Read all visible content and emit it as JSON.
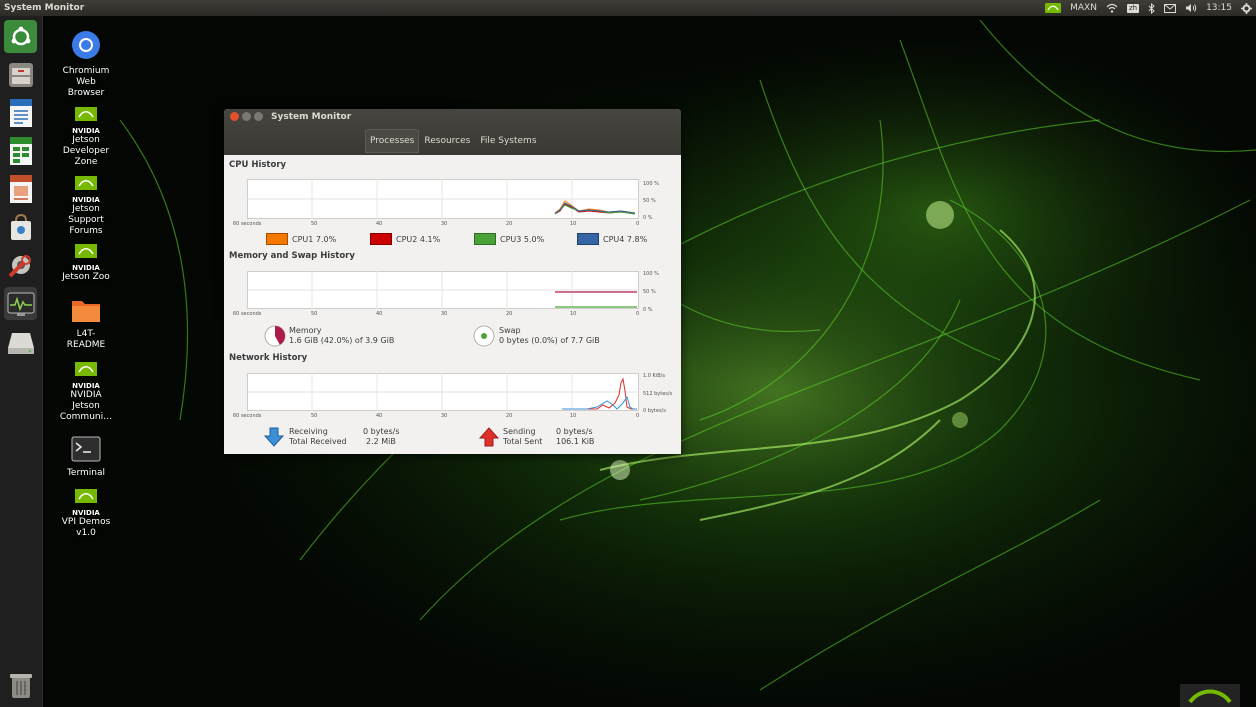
{
  "top_panel": {
    "app_title": "System Monitor",
    "tray": {
      "power_mode": "MAXN",
      "keyboard": "zh",
      "time": "13:15"
    },
    "icons": [
      "nvidia-icon",
      "wifi-icon",
      "keyboard-icon",
      "bluetooth-icon",
      "mail-icon",
      "volume-icon",
      "gear-icon"
    ]
  },
  "launcher": {
    "items": [
      "ubuntu-dash",
      "files",
      "writer",
      "calc",
      "impress",
      "software-center",
      "system-settings",
      "system-monitor",
      "disk",
      "trash"
    ]
  },
  "desktop": {
    "icons": [
      {
        "label": "Chromium\nWeb\nBrowser",
        "icon": "chromium-icon"
      },
      {
        "label": "Jetson\nDeveloper\nZone",
        "brand": "NVIDIA",
        "icon": "nvidia-icon"
      },
      {
        "label": "Jetson\nSupport\nForums",
        "brand": "NVIDIA",
        "icon": "nvidia-icon"
      },
      {
        "label": "Jetson Zoo",
        "brand": "NVIDIA",
        "icon": "nvidia-icon"
      },
      {
        "label": "L4T-\nREADME",
        "icon": "folder-icon"
      },
      {
        "label": "NVIDIA\nJetson\nCommuni…",
        "brand": "NVIDIA",
        "icon": "nvidia-icon"
      },
      {
        "label": "Terminal",
        "icon": "terminal-icon"
      },
      {
        "label": "VPI Demos\nv1.0",
        "brand": "NVIDIA",
        "icon": "nvidia-icon"
      }
    ]
  },
  "window": {
    "title": "System Monitor",
    "tabs": [
      {
        "label": "Processes",
        "active": true
      },
      {
        "label": "Resources",
        "active": false
      },
      {
        "label": "File Systems",
        "active": false
      }
    ],
    "cpu": {
      "title": "CPU History",
      "x_ticks": [
        "60 seconds",
        "50",
        "40",
        "30",
        "20",
        "10",
        "0"
      ],
      "y_ticks": [
        "100 %",
        "50 %",
        "0 %"
      ],
      "cores": [
        {
          "name": "CPU1",
          "value": "7.0%",
          "color": "#f57900"
        },
        {
          "name": "CPU2",
          "value": "4.1%",
          "color": "#cc0000"
        },
        {
          "name": "CPU3",
          "value": "5.0%",
          "color": "#4aa337"
        },
        {
          "name": "CPU4",
          "value": "7.8%",
          "color": "#3465a4"
        }
      ]
    },
    "memory": {
      "title": "Memory and Swap History",
      "x_ticks": [
        "60 seconds",
        "50",
        "40",
        "30",
        "20",
        "10",
        "0"
      ],
      "y_ticks": [
        "100 %",
        "50 %",
        "0 %"
      ],
      "memory": {
        "label": "Memory",
        "value": "1.6 GiB (42.0%) of 3.9 GiB",
        "color": "#ad1b4a",
        "percent": 42.0
      },
      "swap": {
        "label": "Swap",
        "value": "0 bytes (0.0%) of 7.7 GiB",
        "color": "#4aa337",
        "percent": 0.0
      }
    },
    "network": {
      "title": "Network History",
      "x_ticks": [
        "60 seconds",
        "50",
        "40",
        "30",
        "20",
        "10",
        "0"
      ],
      "y_ticks": [
        "1.0 KiB/s",
        "512 bytes/s",
        "0 bytes/s"
      ],
      "receiving": {
        "label": "Receiving",
        "rate": "0 bytes/s",
        "total_label": "Total Received",
        "total": "2.2 MiB",
        "color": "#3a8fd6"
      },
      "sending": {
        "label": "Sending",
        "rate": "0 bytes/s",
        "total_label": "Total Sent",
        "total": "106.1 KiB",
        "color": "#e0302a"
      }
    }
  }
}
